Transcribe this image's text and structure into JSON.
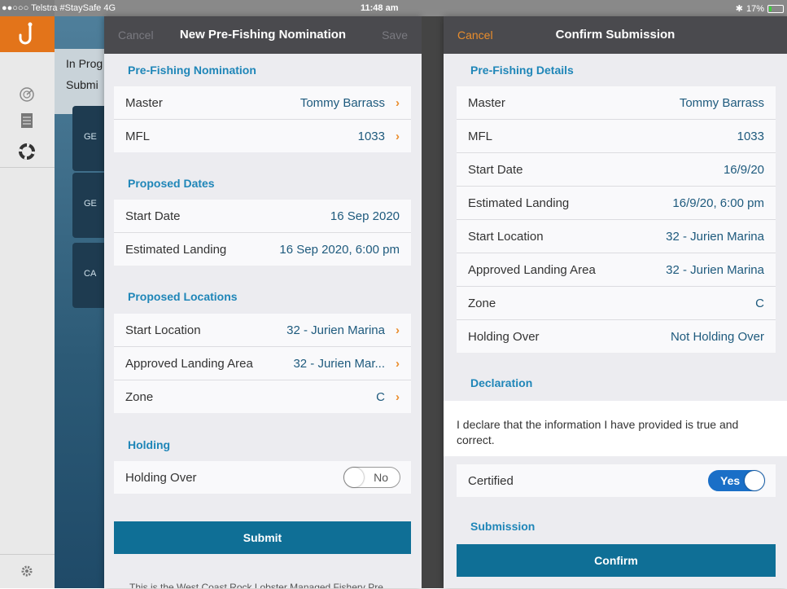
{
  "status_bar": {
    "carrier": "●●○○○ Telstra #StaySafe  4G",
    "time": "11:48 am",
    "battery": "17%"
  },
  "background_app": {
    "header_line1": "In Prog",
    "header_line2": "Submi",
    "cards": [
      "GE",
      "GE",
      "CA"
    ]
  },
  "nomination": {
    "cancel": "Cancel",
    "title": "New Pre-Fishing Nomination",
    "save": "Save",
    "sections": {
      "nomination": "Pre-Fishing Nomination",
      "dates": "Proposed Dates",
      "locations": "Proposed Locations",
      "holding": "Holding"
    },
    "rows": {
      "master": {
        "label": "Master",
        "value": "Tommy Barrass"
      },
      "mfl": {
        "label": "MFL",
        "value": "1033"
      },
      "start_date": {
        "label": "Start Date",
        "value": "16 Sep 2020"
      },
      "estimated_landing": {
        "label": "Estimated Landing",
        "value": "16 Sep 2020, 6:00 pm"
      },
      "start_location": {
        "label": "Start Location",
        "value": "32 - Jurien Marina"
      },
      "approved_landing": {
        "label": "Approved Landing Area",
        "value": "32 - Jurien Mar..."
      },
      "zone": {
        "label": "Zone",
        "value": "C"
      },
      "holding_over": {
        "label": "Holding Over",
        "toggle": "No"
      }
    },
    "submit": "Submit",
    "footer": "This is the West Coast Rock Lobster Managed Fishery Pre"
  },
  "confirm": {
    "cancel": "Cancel",
    "title": "Confirm Submission",
    "sections": {
      "details": "Pre-Fishing Details",
      "declaration": "Declaration",
      "submission": "Submission"
    },
    "rows": {
      "master": {
        "label": "Master",
        "value": "Tommy Barrass"
      },
      "mfl": {
        "label": "MFL",
        "value": "1033"
      },
      "start_date": {
        "label": "Start Date",
        "value": "16/9/20"
      },
      "estimated_landing": {
        "label": "Estimated Landing",
        "value": "16/9/20, 6:00 pm"
      },
      "start_location": {
        "label": "Start Location",
        "value": "32 - Jurien Marina"
      },
      "approved_landing": {
        "label": "Approved Landing Area",
        "value": "32 - Jurien Marina"
      },
      "zone": {
        "label": "Zone",
        "value": "C"
      },
      "holding_over": {
        "label": "Holding Over",
        "value": "Not Holding Over"
      }
    },
    "declaration_text": "I declare that the information I have provided is true and correct.",
    "certified": {
      "label": "Certified",
      "toggle": "Yes"
    },
    "confirm_button": "Confirm"
  },
  "colors": {
    "accent_orange": "#ea8d2c",
    "section_blue": "#1f86b8",
    "button_blue": "#0f6f96",
    "toggle_on": "#1a6fc7",
    "navbar": "#4a4a4e"
  },
  "icons": {
    "app": "fish-hook-icon",
    "radar": "radar-icon",
    "list": "list-icon",
    "help": "lifebuoy-icon",
    "settings": "gear-icon"
  }
}
